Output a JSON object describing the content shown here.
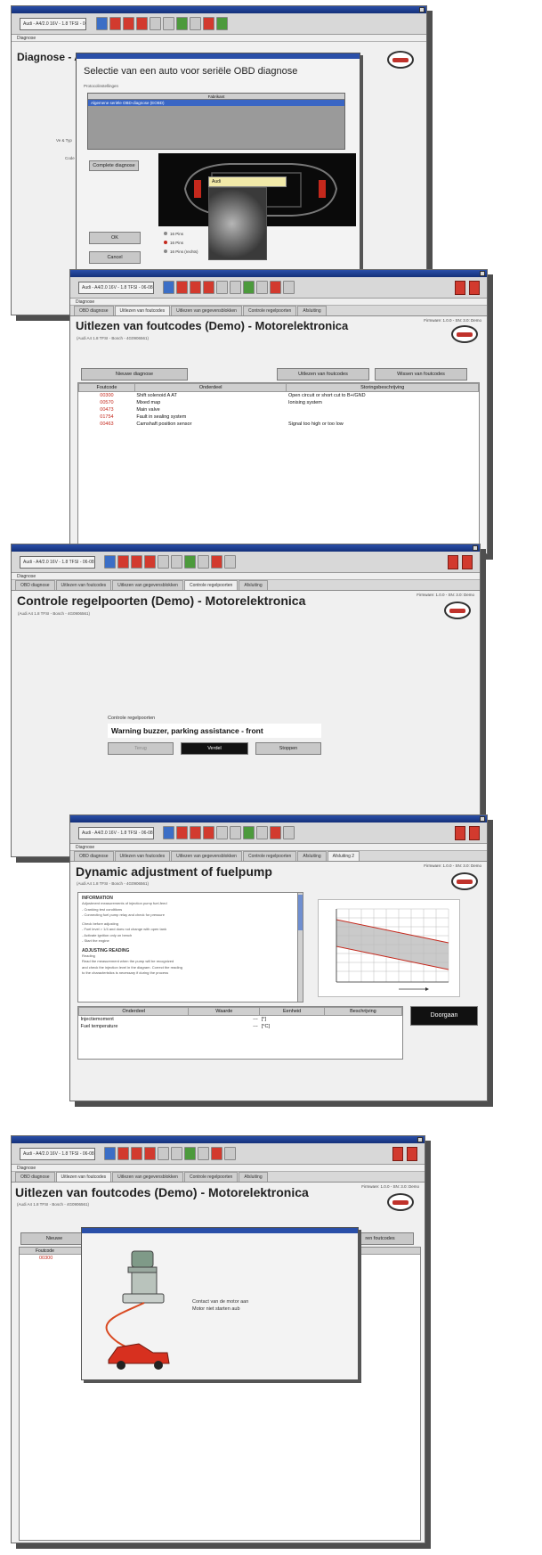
{
  "common": {
    "toolbar_combo": "Audi - A4/2.0 16V - 1.8 TFSI - 06-08",
    "menu_label": "Diagnose",
    "firmware": "Firmware: 1.0.0 - SN: 3.0: Demo"
  },
  "screen1": {
    "page_title": "Diagnose - A",
    "dialog_title": "Selectie van een auto voor seriële OBD diagnose",
    "section_label": "Protocolinstellingen",
    "list_header": "Fabrikant",
    "list_selected": "Algemene seriële OBD-diagnose (EOBD)",
    "bg_rows": [
      "Ve & Typ",
      "Code"
    ],
    "btn_complete": "Complete diagnose",
    "btn_ok": "OK",
    "btn_cancel": "Cancel",
    "tooltip": "Audi",
    "radios": [
      "16 Pins",
      "16 Pins",
      "16 Pins (rechts)"
    ]
  },
  "screen2": {
    "tabs": [
      "OBD diagnose",
      "Uitlezen van foutcodes",
      "Uitlezen van gegevensblokken",
      "Controle regelpoorten",
      "Afsluiting"
    ],
    "page_title": "Uitlezen van foutcodes (Demo) - Motorelektronica",
    "subtitle": "(Audi A4 1.8 TFSI - Bosch - 4G0906561)",
    "btn_new": "Nieuwe diagnose",
    "btn_read": "Uitlezen van foutcodes",
    "btn_clear": "Wissen van foutcodes",
    "headers": [
      "Foutcode",
      "Onderdeel",
      "Storingsbeschrijving"
    ],
    "rows": [
      [
        "00300",
        "Shift solenoid A AT",
        "Open circuit or short cut to B+/GND"
      ],
      [
        "00570",
        "Mixed map",
        "Ionising system"
      ],
      [
        "00473",
        "Main valve",
        ""
      ],
      [
        "01754",
        "Fault in sealing system",
        ""
      ],
      [
        "00463",
        "Camshaft position sensor",
        "Signal too high or too low"
      ]
    ]
  },
  "screen3": {
    "tabs": [
      "OBD diagnose",
      "Uitlezen van foutcodes",
      "Uitlezen van gegevensblokken",
      "Controle regelpoorten",
      "Afsluiting"
    ],
    "page_title": "Controle regelpoorten (Demo) - Motorelektronica",
    "subtitle": "(Audi A4 1.8 TFSI - Bosch - 4G0906561)",
    "control_label": "Controle regelpoorten",
    "control_value": "Warning buzzer, parking assistance - front",
    "btn_back": "Terug",
    "btn_start": "Verdel",
    "btn_stop": "Stoppen"
  },
  "screen4": {
    "tabs": [
      "OBD diagnose",
      "Uitlezen van foutcodes",
      "Uitlezen van gegevensblokken",
      "Controle regelpoorten",
      "Afsluiting",
      "Afsluiting 2"
    ],
    "page_title": "Dynamic adjustment of fuelpump",
    "subtitle": "(Audi A4 1.8 TFSI - Bosch - 4G0906561)",
    "info_heading": "INFORMATION",
    "info_lines": [
      "Adjustment measurements of injection pump fuel-feed",
      "- Cranking test conditions",
      "- Connecting fuel pump relay and check for pressure",
      "Check before adjusting",
      "- Fuel level > 1/4 and does not change with open tank",
      "- Activate ignition only on bench",
      "- Start the engine"
    ],
    "adjust_heading": "ADJUSTING READING",
    "adjust_lines": [
      "Reading",
      "Read the measurement when the pump will be recognized",
      "and check the injection level in the diagram. Correct the reading",
      "to the characteristics is necessary if during the process"
    ],
    "headers": [
      "Onderdeel",
      "Waarde",
      "Eenheid",
      "Beschrijving"
    ],
    "rows": [
      [
        "Injectiemoment",
        "---",
        "[°]",
        ""
      ],
      [
        "Fuel temperature",
        "---",
        "[°C]",
        ""
      ]
    ],
    "btn_continue": "Doorgaan"
  },
  "screen5": {
    "tabs": [
      "OBD diagnose",
      "Uitlezen van foutcodes",
      "Uitlezen van gegevensblokken",
      "Controle regelpoorten",
      "Afsluiting"
    ],
    "page_title": "Uitlezen van foutcodes (Demo) - Motorelektronica",
    "subtitle": "(Audi A4 1.8 TFSI - Bosch - 4G0906561)",
    "btn_new": "Nieuwe",
    "btn_clear": "ren foutcodes",
    "header_code": "Foutcode",
    "row_code": "00300",
    "popup_line1": "Contact van de motor aan",
    "popup_line2": "Motor niet starten aub"
  },
  "colors": {
    "title_blue": "#2a4fa8",
    "error_red": "#c4281c",
    "selection_blue": "#3a66c4"
  }
}
